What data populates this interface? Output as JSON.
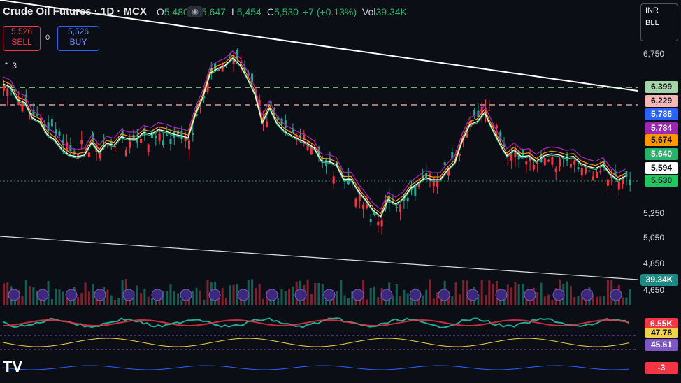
{
  "header": {
    "symbol": "Crude Oil Futures · 1D · MCX",
    "open_label": "O",
    "open": "5,480",
    "high_label": "H",
    "high": "5,647",
    "low_label": "L",
    "low": "5,454",
    "close_label": "C",
    "close": "5,530",
    "change": "+7 (+0.13%)",
    "vol_label": "Vol",
    "volume": "39.34K",
    "eye_icon": "eye-icon"
  },
  "trade": {
    "sell_price": "5,526",
    "sell_label": "SELL",
    "spread": "0",
    "buy_price": "5,526",
    "buy_label": "BUY"
  },
  "indicators_toggle": "3",
  "currency_menu": {
    "currency": "INR",
    "exchange": "BLL"
  },
  "price_axis": {
    "ticks": [
      "6,750",
      "5,250",
      "5,050",
      "4,850",
      "4,650"
    ]
  },
  "price_labels": [
    {
      "value": "6,399",
      "bg": "#a5d6a7",
      "fg": "#0c0e15"
    },
    {
      "value": "6,229",
      "bg": "#f7b7b7",
      "fg": "#0c0e15"
    },
    {
      "value": "5,786",
      "bg": "#2962ff",
      "fg": "#ffffff"
    },
    {
      "value": "5,784",
      "bg": "#9c27b0",
      "fg": "#ffffff"
    },
    {
      "value": "5,674",
      "bg": "#ff9800",
      "fg": "#0c0e15"
    },
    {
      "value": "5,640",
      "bg": "#27b36b",
      "fg": "#ffffff"
    },
    {
      "value": "5,594",
      "bg": "#ffffff",
      "fg": "#0c0e15"
    },
    {
      "value": "5,530",
      "bg": "#22c55e",
      "fg": "#0c0e15"
    }
  ],
  "volume_label": "39.34K",
  "sub_labels": [
    {
      "value": "6.55K",
      "bg": "#f23645",
      "fg": "#ffffff"
    },
    {
      "value": "47.78",
      "bg": "#f0d14a",
      "fg": "#0c0e15"
    },
    {
      "value": "45.61",
      "bg": "#7e57c2",
      "fg": "#ffffff"
    },
    {
      "value": "-3",
      "bg": "#f23645",
      "fg": "#ffffff"
    }
  ],
  "colors": {
    "up": "#22ab94",
    "down": "#f23645",
    "bg": "#0c0e15"
  },
  "chart_data": {
    "type": "candlestick",
    "y_axis_ticks": [
      6750,
      5250,
      5050,
      4850,
      4650
    ],
    "horizontal_levels": [
      6399,
      6229
    ],
    "last_close": 5530
  }
}
